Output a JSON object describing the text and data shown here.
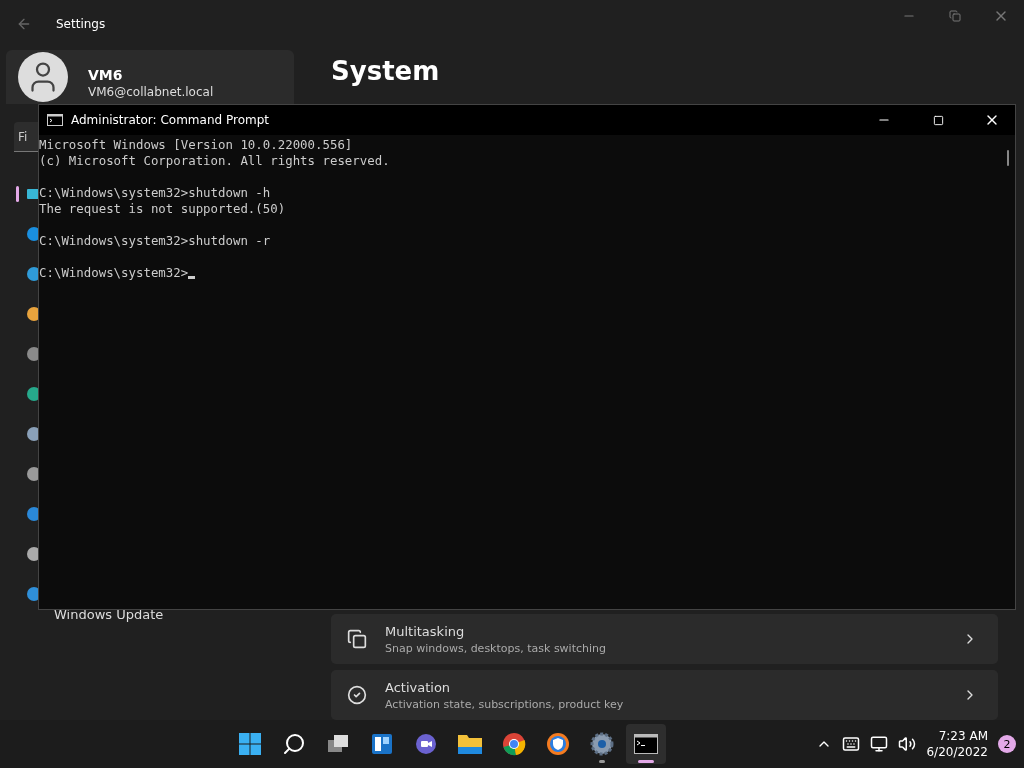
{
  "settings_window": {
    "title": "Settings",
    "profile": {
      "name": "VM6",
      "email": "VM6@collabnet.local"
    },
    "search": {
      "placeholder": "Fi"
    },
    "sidebar": {
      "items": [
        {
          "selected": true
        },
        {
          "selected": false
        },
        {
          "selected": false
        },
        {
          "selected": false
        },
        {
          "selected": false
        },
        {
          "selected": false
        },
        {
          "selected": false
        },
        {
          "selected": false
        },
        {
          "selected": false
        },
        {
          "selected": false
        },
        {
          "selected": false,
          "label": "Windows Update"
        }
      ]
    },
    "page_title": "System",
    "cards": [
      {
        "title": "Multitasking",
        "subtitle": "Snap windows, desktops, task switching"
      },
      {
        "title": "Activation",
        "subtitle": "Activation state, subscriptions, product key"
      }
    ]
  },
  "cmd_window": {
    "title": "Administrator: Command Prompt",
    "blocks": [
      [
        "Microsoft Windows [Version 10.0.22000.556]",
        "(c) Microsoft Corporation. All rights reserved."
      ],
      [
        "C:\\Windows\\system32>shutdown -h",
        "The request is not supported.(50)"
      ],
      [
        "C:\\Windows\\system32>shutdown -r"
      ],
      [
        "C:\\Windows\\system32>"
      ]
    ]
  },
  "taskbar": {
    "apps": [
      {
        "kind": "start",
        "running": false,
        "selected": false
      },
      {
        "kind": "search",
        "running": false,
        "selected": false
      },
      {
        "kind": "taskview",
        "running": false,
        "selected": false
      },
      {
        "kind": "widgets",
        "running": false,
        "selected": false
      },
      {
        "kind": "chat",
        "running": false,
        "selected": false
      },
      {
        "kind": "explorer",
        "running": false,
        "selected": false
      },
      {
        "kind": "chrome",
        "running": false,
        "selected": false
      },
      {
        "kind": "browser",
        "running": false,
        "selected": false
      },
      {
        "kind": "settings",
        "running": true,
        "selected": false
      },
      {
        "kind": "terminal",
        "running": true,
        "selected": true
      }
    ],
    "time": "7:23 AM",
    "date": "6/20/2022",
    "notifications": "2"
  }
}
